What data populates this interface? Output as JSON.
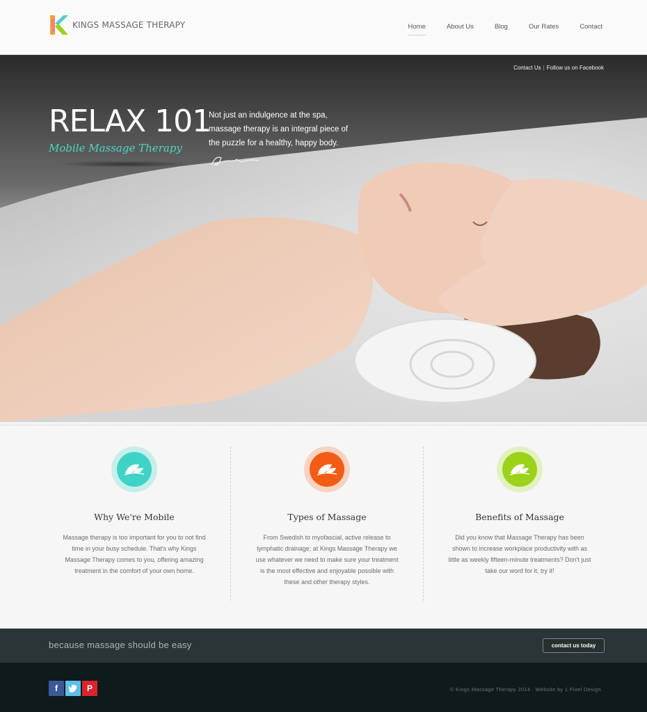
{
  "header": {
    "brand": "KINGS MASSAGE THERAPY",
    "nav": [
      "Home",
      "About Us",
      "Blog",
      "Our Rates",
      "Contact"
    ],
    "active_nav": "Home"
  },
  "hero": {
    "top_links": [
      "Contact Us",
      "Follow us on Facebook"
    ],
    "title": "RELAX 101",
    "subtitle": "Mobile Massage Therapy",
    "intro_lines": [
      "Not just an indulgence at the spa,",
      "massage therapy is an integral piece of",
      "the puzzle for a healthy, happy body."
    ]
  },
  "features": [
    {
      "icon": "leaf-icon",
      "color": "#3ed3c6",
      "ring": "#c8eeea",
      "title": "Why We're Mobile",
      "text": "Massage therapy is too important for you to not find time in your busy schedule. That's why Kings Massage Therapy comes to you, offering amazing treatment in the comfort of your own home."
    },
    {
      "icon": "leaf-icon",
      "color": "#f25c14",
      "ring": "#f7d3c1",
      "title": "Types of Massage",
      "text": "From Swedish to myofascial, active release to lymphatic drainage; at Kings Massage Therapy we use whatever we need to make sure your treatment is the most effective and enjoyable possible with these and other therapy styles."
    },
    {
      "icon": "leaf-icon",
      "color": "#9bd21a",
      "ring": "#e2f1c0",
      "title": "Benefits of Massage",
      "text": "Did you know that Massage Therapy has been shown to increase workplace productivity with as little as weekly fifteen-minute treatments?  Don't just take our word for it, try it!"
    }
  ],
  "tagbar": {
    "tagline": "because massage should be easy",
    "cta": "contact us today"
  },
  "footer": {
    "socials": [
      {
        "name": "facebook-icon",
        "glyph": "f",
        "color": "#3b5998"
      },
      {
        "name": "twitter-icon",
        "glyph": "t",
        "color": "#5ebfe8"
      },
      {
        "name": "pinterest-icon",
        "glyph": "P",
        "color": "#d9252b"
      }
    ],
    "copyright": "© Kings Massage Therapy 2014 . Website by 1 Pixel Design"
  }
}
